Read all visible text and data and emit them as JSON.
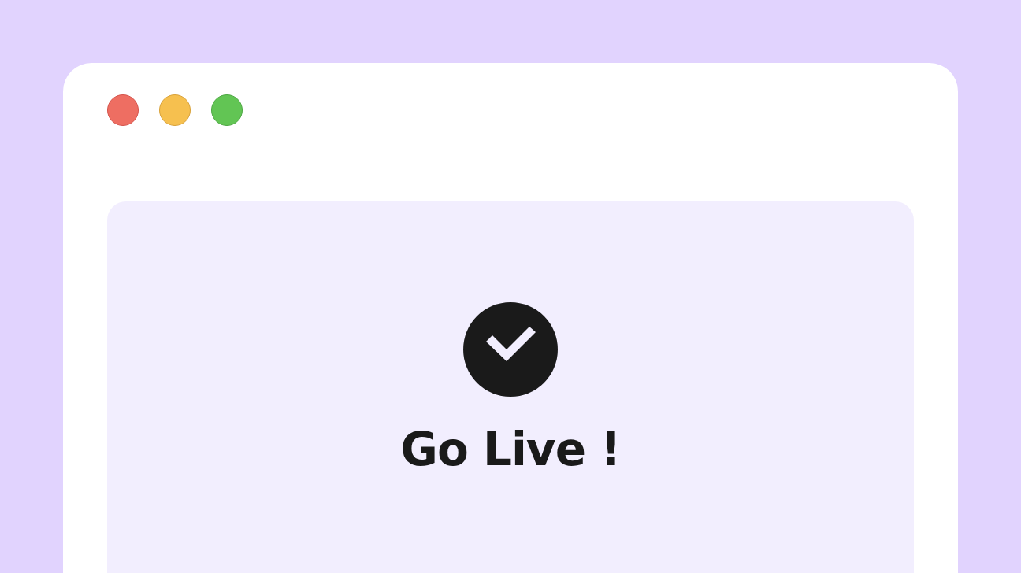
{
  "window": {
    "controls": [
      {
        "kind": "close"
      },
      {
        "kind": "minimize"
      },
      {
        "kind": "maximize"
      }
    ]
  },
  "card": {
    "title": "Go Live !"
  }
}
